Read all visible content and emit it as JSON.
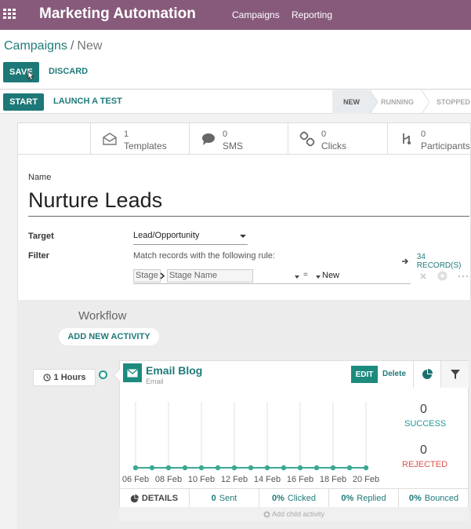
{
  "navbar": {
    "app_title": "Marketing Automation",
    "menu": [
      "Campaigns",
      "Reporting"
    ]
  },
  "breadcrumb": {
    "parent": "Campaigns",
    "separator": "/",
    "current": "New"
  },
  "buttons": {
    "save": "SAVE",
    "discard": "DISCARD",
    "start": "START",
    "launch_test": "LAUNCH A TEST",
    "edit": "EDIT",
    "delete": "Delete",
    "add_activity": "ADD NEW ACTIVITY"
  },
  "stages": [
    {
      "label": "NEW",
      "active": true
    },
    {
      "label": "RUNNING",
      "active": false
    },
    {
      "label": "STOPPED",
      "active": false
    }
  ],
  "stat_buttons": [
    {
      "count": "1",
      "label": "Templates",
      "icon": "envelope-icon"
    },
    {
      "count": "0",
      "label": "SMS",
      "icon": "speech-bubble-icon"
    },
    {
      "count": "0",
      "label": "Clicks",
      "icon": "link-icon"
    },
    {
      "count": "0",
      "label": "Participants",
      "icon": "participants-icon"
    }
  ],
  "form": {
    "name_label": "Name",
    "name_value": "Nurture Leads",
    "target_label": "Target",
    "target_value": "Lead/Opportunity",
    "filter_label": "Filter",
    "filter_rule_text": "Match records with the following rule:",
    "records_count": "34 RECORD(S)",
    "rule": {
      "field": "Stage",
      "subfield": "Stage Name",
      "operator": "=",
      "value": "New"
    }
  },
  "workflow": {
    "title": "Workflow",
    "interval": "1 Hours",
    "activity": {
      "title": "Email Blog",
      "type": "Email",
      "success_count": "0",
      "success_label": "SUCCESS",
      "rejected_count": "0",
      "rejected_label": "REJECTED",
      "footer": {
        "details": "DETAILS",
        "sent_value": "0",
        "sent_label": "Sent",
        "clicked_value": "0%",
        "clicked_label": "Clicked",
        "replied_value": "0%",
        "replied_label": "Replied",
        "bounced_value": "0%",
        "bounced_label": "Bounced"
      },
      "add_child": "Add child activity"
    }
  },
  "chart_data": {
    "type": "line",
    "x": [
      "06 Feb",
      "07 Feb",
      "08 Feb",
      "09 Feb",
      "10 Feb",
      "11 Feb",
      "12 Feb",
      "13 Feb",
      "14 Feb",
      "15 Feb",
      "16 Feb",
      "17 Feb",
      "18 Feb",
      "19 Feb",
      "20 Feb"
    ],
    "tick_labels": [
      "06 Feb",
      "08 Feb",
      "10 Feb",
      "12 Feb",
      "14 Feb",
      "16 Feb",
      "18 Feb",
      "20 Feb"
    ],
    "series": [
      {
        "values": [
          0,
          0,
          0,
          0,
          0,
          0,
          0,
          0,
          0,
          0,
          0,
          0,
          0,
          0,
          0
        ],
        "color": "#3aa892"
      }
    ],
    "ylim": [
      0,
      1
    ],
    "grid": true
  },
  "colors": {
    "brand": "#875a7b",
    "primary": "#1d7877",
    "link": "#1f7a7a",
    "rejected": "#d9534f",
    "success": "#1f9a9a"
  }
}
